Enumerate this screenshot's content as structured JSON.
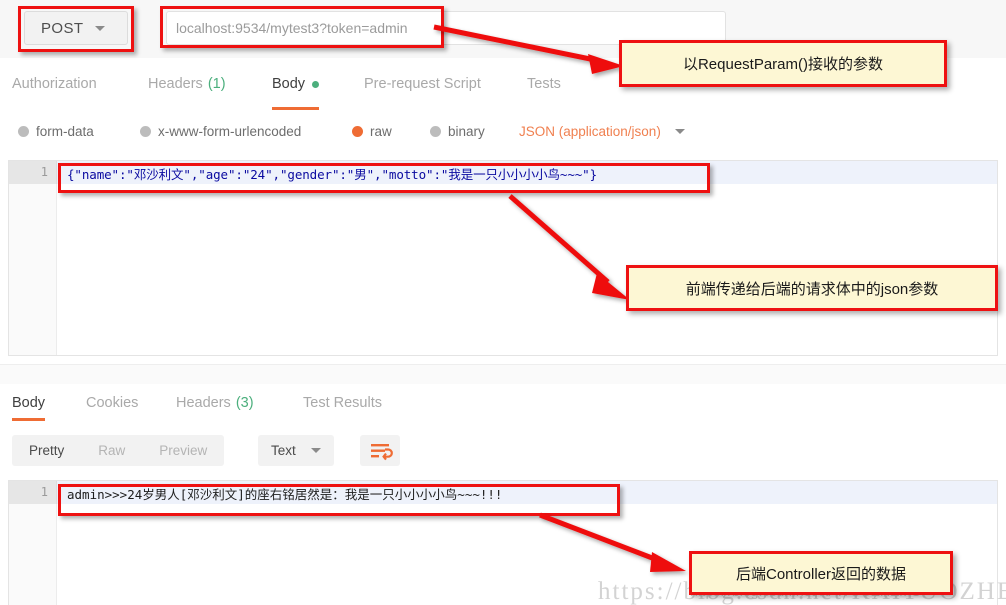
{
  "request": {
    "method": "POST",
    "url": "localhost:9534/mytest3?token=admin",
    "tabs": [
      {
        "label": "Authorization",
        "active": false,
        "marker": ""
      },
      {
        "label": "Headers",
        "active": false,
        "marker": "(1)"
      },
      {
        "label": "Body",
        "active": true,
        "marker": "dot"
      },
      {
        "label": "Pre-request Script",
        "active": false,
        "marker": ""
      },
      {
        "label": "Tests",
        "active": false,
        "marker": ""
      }
    ],
    "body_types": [
      {
        "label": "form-data",
        "selected": false
      },
      {
        "label": "x-www-form-urlencoded",
        "selected": false
      },
      {
        "label": "raw",
        "selected": true
      },
      {
        "label": "binary",
        "selected": false
      }
    ],
    "content_type": "JSON (application/json)",
    "editor": {
      "line_number": "1",
      "code": "{\"name\":\"邓沙利文\",\"age\":\"24\",\"gender\":\"男\",\"motto\":\"我是一只小小小小鸟~~~\"}"
    }
  },
  "response": {
    "tabs": [
      {
        "label": "Body",
        "active": true,
        "marker": ""
      },
      {
        "label": "Cookies",
        "active": false,
        "marker": ""
      },
      {
        "label": "Headers",
        "active": false,
        "marker": "(3)"
      },
      {
        "label": "Test Results",
        "active": false,
        "marker": ""
      }
    ],
    "view_modes": [
      {
        "label": "Pretty",
        "active": true
      },
      {
        "label": "Raw",
        "active": false
      },
      {
        "label": "Preview",
        "active": false
      }
    ],
    "format": "Text",
    "wrap_icon": "word-wrap-icon",
    "editor": {
      "line_number": "1",
      "code": "admin>>>24岁男人[邓沙利文]的座右铭居然是：我是一只小小小小鸟~~~!!!"
    }
  },
  "annotations": {
    "callout_1": "以RequestParam()接收的参数",
    "callout_2": "前端传递给后端的请求体中的json参数",
    "callout_3": "后端Controller返回的数据",
    "accent_red": "#ee1111",
    "callout_bg": "#fdf7d4"
  },
  "watermark": {
    "big": "https://blog.csdn.net/KAITUOZHEMU",
    "small": "https://blog.csdn.net/KAITUOZHEMU"
  },
  "colors": {
    "orange": "#ef6c34",
    "green": "#4caf7d",
    "text_muted": "#a9a9a9"
  }
}
